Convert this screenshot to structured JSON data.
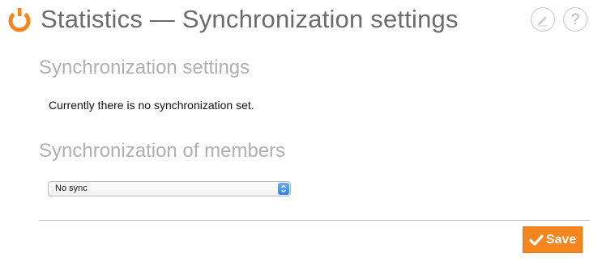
{
  "header": {
    "title": "Statistics — Synchronization settings",
    "logo_icon": "brand-logo-ring-icon",
    "edit_icon": "pencil-icon",
    "help_label": "?",
    "accent_color": "#f5861f"
  },
  "sections": {
    "sync_settings_title": "Synchronization settings",
    "sync_settings_text": "Currently there is no synchronization set.",
    "members_title": "Synchronization of members"
  },
  "members_select": {
    "selected": "No sync"
  },
  "footer": {
    "save_label": "Save",
    "save_icon": "checkmark-icon",
    "save_color": "#f5861f"
  }
}
